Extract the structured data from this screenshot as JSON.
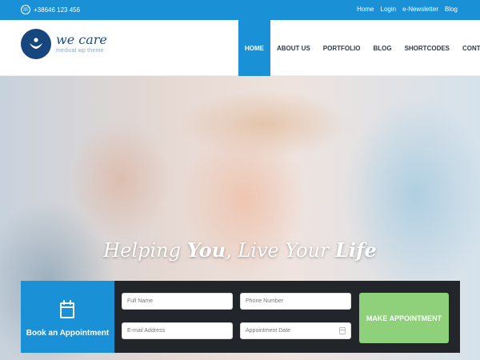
{
  "topbar": {
    "phone": "+38646 123 456",
    "links": [
      "Home",
      "Login",
      "e-Newsletter",
      "Blog"
    ]
  },
  "logo": {
    "title": "we care",
    "subtitle": "medical wp theme"
  },
  "nav": {
    "items": [
      "HOME",
      "ABOUT US",
      "PORTFOLIO",
      "BLOG",
      "SHORTCODES",
      "CONTACT US"
    ],
    "active": "HOME"
  },
  "hero": {
    "title_part1": "Helping ",
    "title_part2": "You",
    "title_part3": ", Live Your ",
    "title_part4": "Life"
  },
  "appointment": {
    "label": "Book an Appointment",
    "fields": {
      "full_name": "Full Name",
      "phone": "Phone Number",
      "email": "E-mail Address",
      "date": "Appointment Date"
    },
    "button": "MAKE APPOINTMENT"
  },
  "colors": {
    "accent": "#1a91d6",
    "logo": "#17467f",
    "button": "#8fd17a",
    "form_bg": "#222529"
  }
}
